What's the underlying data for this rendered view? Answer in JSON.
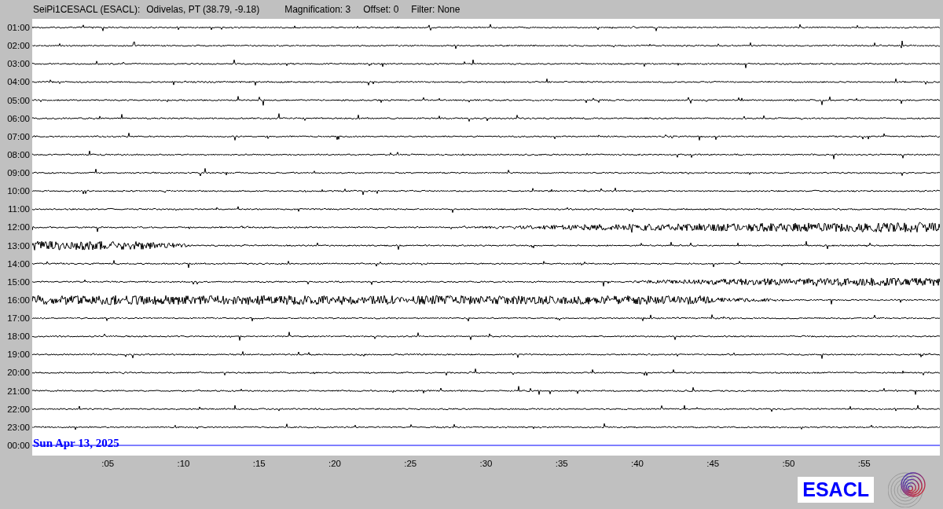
{
  "header": {
    "station": "SeiPi1CESACL (ESACL):",
    "location": "Odivelas, PT (38.79, -9.18)",
    "magnification": "Magnification: 3",
    "offset": "Offset: 0",
    "filter": "Filter: None"
  },
  "rows": [
    {
      "label": "01:00",
      "kind": "trace"
    },
    {
      "label": "02:00",
      "kind": "trace"
    },
    {
      "label": "03:00",
      "kind": "trace"
    },
    {
      "label": "04:00",
      "kind": "trace"
    },
    {
      "label": "05:00",
      "kind": "trace"
    },
    {
      "label": "06:00",
      "kind": "trace"
    },
    {
      "label": "07:00",
      "kind": "trace"
    },
    {
      "label": "08:00",
      "kind": "trace"
    },
    {
      "label": "09:00",
      "kind": "trace"
    },
    {
      "label": "10:00",
      "kind": "trace"
    },
    {
      "label": "11:00",
      "kind": "trace"
    },
    {
      "label": "12:00",
      "kind": "trace"
    },
    {
      "label": "13:00",
      "kind": "trace"
    },
    {
      "label": "14:00",
      "kind": "trace"
    },
    {
      "label": "15:00",
      "kind": "trace"
    },
    {
      "label": "16:00",
      "kind": "trace"
    },
    {
      "label": "17:00",
      "kind": "trace"
    },
    {
      "label": "18:00",
      "kind": "trace"
    },
    {
      "label": "19:00",
      "kind": "trace"
    },
    {
      "label": "20:00",
      "kind": "trace"
    },
    {
      "label": "21:00",
      "kind": "trace"
    },
    {
      "label": "22:00",
      "kind": "trace"
    },
    {
      "label": "23:00",
      "kind": "trace"
    },
    {
      "label": "00:00",
      "kind": "current"
    }
  ],
  "date": "Sun Apr 13, 2025",
  "x_ticks": [
    ":05",
    ":10",
    ":15",
    ":20",
    ":25",
    ":30",
    ":35",
    ":40",
    ":45",
    ":50",
    ":55"
  ],
  "logo_text": "ESACL"
}
